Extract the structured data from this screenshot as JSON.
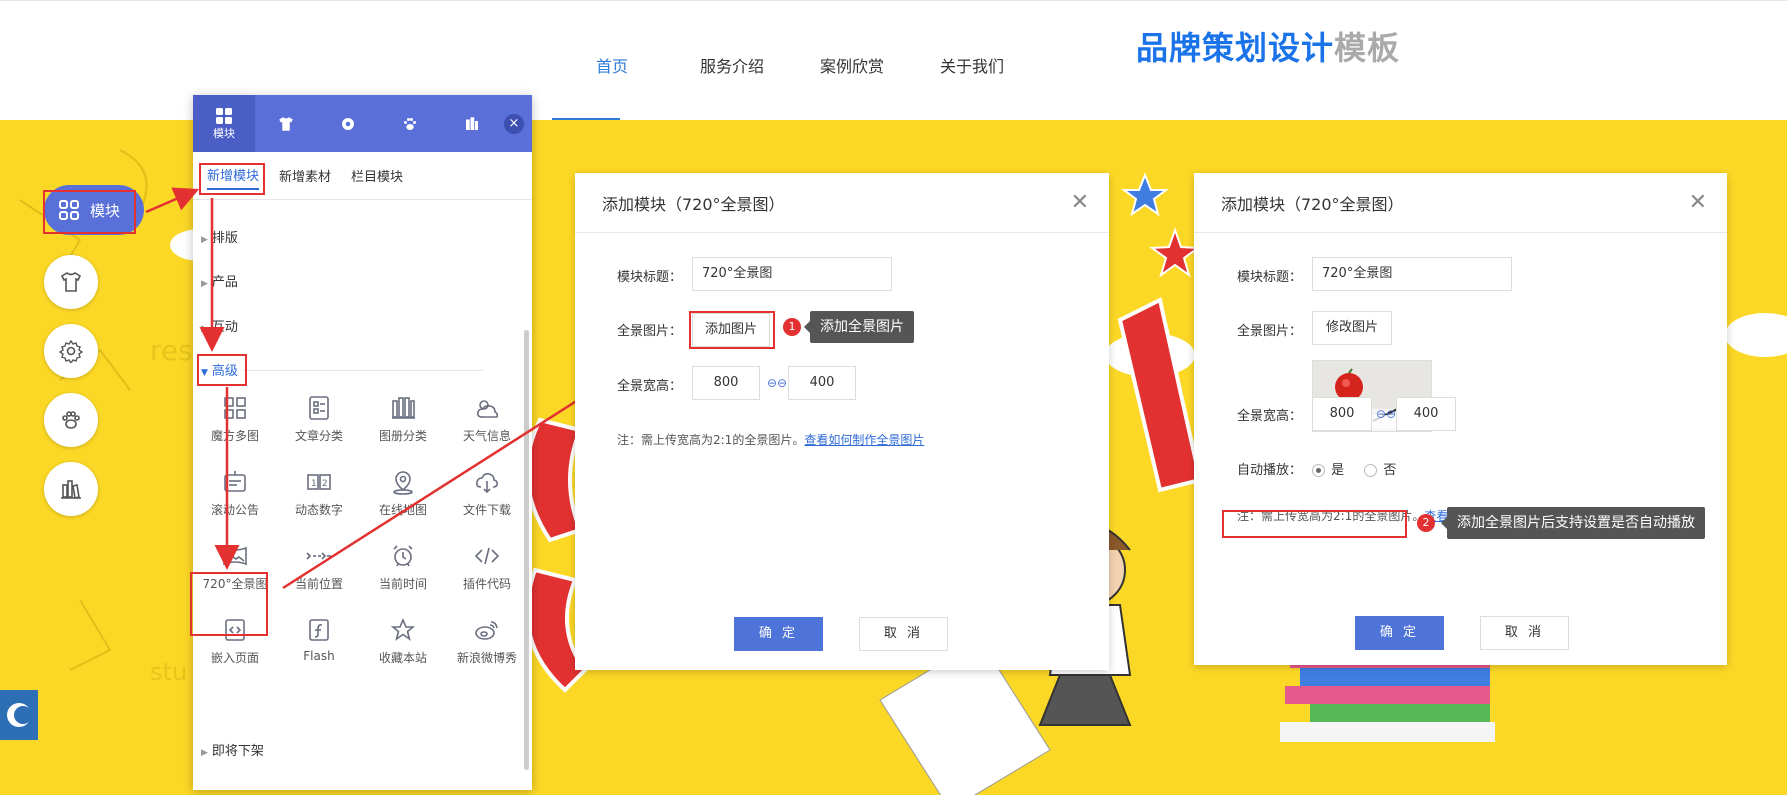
{
  "header": {
    "nav": [
      "首页",
      "服务介绍",
      "案例欣赏",
      "关于我们"
    ],
    "brand_main": "品牌策划设计",
    "brand_sub": "模板"
  },
  "leftbar": {
    "module_label": "模块"
  },
  "panel": {
    "tabs": [
      {
        "label": "模块",
        "icon": "grid-icon"
      },
      {
        "label": "",
        "icon": "shirt-icon"
      },
      {
        "label": "",
        "icon": "gear-icon"
      },
      {
        "label": "",
        "icon": "paw-icon"
      },
      {
        "label": "",
        "icon": "books-icon"
      }
    ],
    "close": "×",
    "subtabs": [
      "新增模块",
      "新增素材",
      "栏目模块"
    ],
    "categories": [
      "排版",
      "产品",
      "互动",
      "高级",
      "即将下架"
    ],
    "items": [
      {
        "label": "魔方多图",
        "icon": "cube-grid-icon"
      },
      {
        "label": "文章分类",
        "icon": "article-icon"
      },
      {
        "label": "图册分类",
        "icon": "album-icon"
      },
      {
        "label": "天气信息",
        "icon": "weather-icon"
      },
      {
        "label": "滚动公告",
        "icon": "notice-icon"
      },
      {
        "label": "动态数字",
        "icon": "number-icon"
      },
      {
        "label": "在线地图",
        "icon": "map-pin-icon"
      },
      {
        "label": "文件下载",
        "icon": "cloud-download-icon"
      },
      {
        "label": "720°全景图",
        "icon": "panorama-icon"
      },
      {
        "label": "当前位置",
        "icon": "breadcrumb-icon"
      },
      {
        "label": "当前时间",
        "icon": "clock-icon"
      },
      {
        "label": "插件代码",
        "icon": "code-icon"
      },
      {
        "label": "嵌入页面",
        "icon": "embed-icon"
      },
      {
        "label": "Flash",
        "icon": "flash-icon"
      },
      {
        "label": "收藏本站",
        "icon": "star-icon"
      },
      {
        "label": "新浪微博秀",
        "icon": "weibo-icon"
      }
    ]
  },
  "dialog1": {
    "title": "添加模块（720°全景图）",
    "title_label": "模块标题：",
    "title_value": "720°全景图",
    "image_label": "全景图片：",
    "add_image": "添加图片",
    "size_label": "全景宽高：",
    "width": "800",
    "height": "400",
    "note": "注：需上传宽高为2:1的全景图片。",
    "note_link": "查看如何制作全景图片",
    "ok": "确 定",
    "cancel": "取 消"
  },
  "dialog2": {
    "title": "添加模块（720°全景图）",
    "title_label": "模块标题：",
    "title_value": "720°全景图",
    "image_label": "全景图片：",
    "modify_image": "修改图片",
    "size_label": "全景宽高：",
    "width": "800",
    "height": "400",
    "autoplay_label": "自动播放：",
    "yes": "是",
    "no": "否",
    "note": "注：需上传宽高为2:1的全景图片。",
    "note_link": "查看如何制作全景图片",
    "ok": "确 定",
    "cancel": "取 消"
  },
  "annotations": {
    "step1": "1",
    "tip1": "添加全景图片",
    "step2": "2",
    "tip2": "添加全景图片后支持设置是否自动播放"
  },
  "colors": {
    "banner": "#fcd826",
    "accent": "#5b6fd8",
    "highlight": "#e33131"
  }
}
